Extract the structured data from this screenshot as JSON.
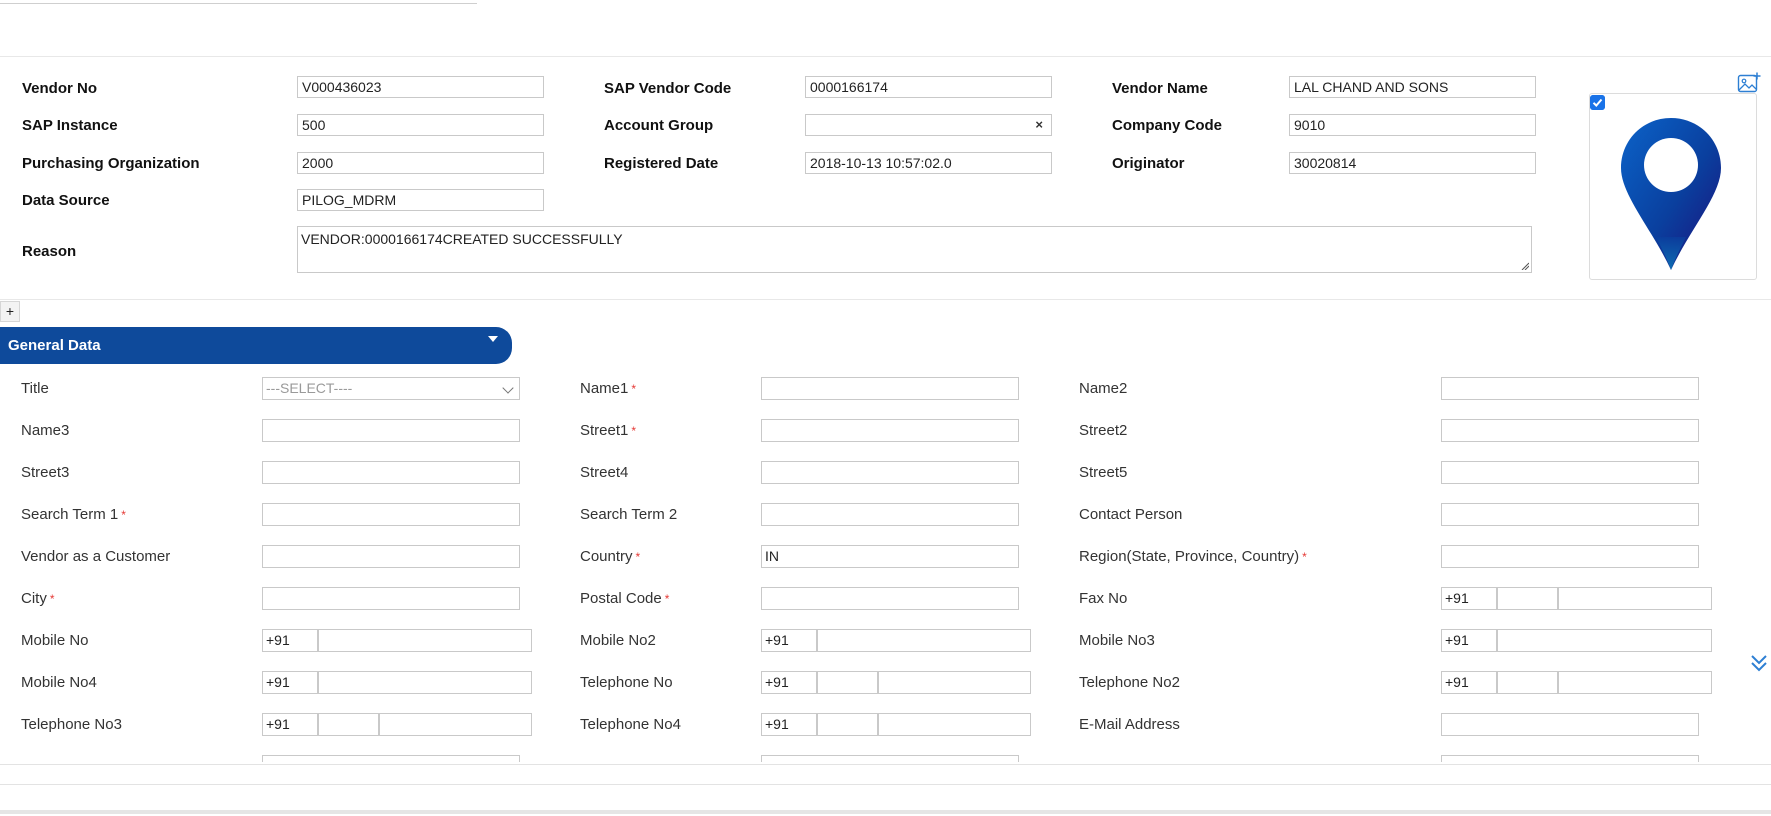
{
  "header": {
    "vendor_no": {
      "label": "Vendor No",
      "value": "V000436023"
    },
    "sap_vendor_code": {
      "label": "SAP Vendor Code",
      "value": "0000166174"
    },
    "vendor_name": {
      "label": "Vendor Name",
      "value": "LAL CHAND AND SONS"
    },
    "sap_instance": {
      "label": "SAP Instance",
      "value": "500"
    },
    "account_group": {
      "label": "Account Group",
      "value": "",
      "clear": "×"
    },
    "company_code": {
      "label": "Company Code",
      "value": "9010"
    },
    "purchasing_org": {
      "label": "Purchasing Organization",
      "value": "2000"
    },
    "registered_date": {
      "label": "Registered Date",
      "value": "2018-10-13 10:57:02.0"
    },
    "originator": {
      "label": "Originator",
      "value": "30020814"
    },
    "data_source": {
      "label": "Data Source",
      "value": "PILOG_MDRM"
    },
    "reason": {
      "label": "Reason",
      "value": "VENDOR:0000166174CREATED SUCCESSFULLY"
    }
  },
  "expand_button": "+",
  "section": {
    "title": "General Data"
  },
  "form": {
    "title": {
      "label": "Title",
      "placeholder": "---SELECT----"
    },
    "name1": {
      "label": "Name1"
    },
    "name2": {
      "label": "Name2"
    },
    "name3": {
      "label": "Name3"
    },
    "street1": {
      "label": "Street1"
    },
    "street2": {
      "label": "Street2"
    },
    "street3": {
      "label": "Street3"
    },
    "street4": {
      "label": "Street4"
    },
    "street5": {
      "label": "Street5"
    },
    "search_term1": {
      "label": "Search Term 1"
    },
    "search_term2": {
      "label": "Search Term 2"
    },
    "contact_person": {
      "label": "Contact Person"
    },
    "vendor_as_customer": {
      "label": "Vendor as a Customer"
    },
    "country": {
      "label": "Country",
      "value": "IN"
    },
    "region": {
      "label": "Region(State, Province, Country)"
    },
    "city": {
      "label": "City"
    },
    "postal_code": {
      "label": "Postal Code"
    },
    "fax_no": {
      "label": "Fax No",
      "code": "+91"
    },
    "mobile_no": {
      "label": "Mobile No",
      "code": "+91"
    },
    "mobile_no2": {
      "label": "Mobile No2",
      "code": "+91"
    },
    "mobile_no3": {
      "label": "Mobile No3",
      "code": "+91"
    },
    "mobile_no4": {
      "label": "Mobile No4",
      "code": "+91"
    },
    "telephone_no": {
      "label": "Telephone No",
      "code": "+91"
    },
    "telephone_no2": {
      "label": "Telephone No2",
      "code": "+91"
    },
    "telephone_no3": {
      "label": "Telephone No3",
      "code": "+91"
    },
    "telephone_no4": {
      "label": "Telephone No4",
      "code": "+91"
    },
    "email": {
      "label": "E-Mail Address"
    },
    "required_mark": "*"
  },
  "colors": {
    "accent": "#0e4a9b",
    "required": "#e53935",
    "checkbox": "#1a73e8"
  },
  "icons": [
    "image-add-icon",
    "location-pin-icon",
    "chevron-down-icon",
    "double-chevron-down-icon",
    "checkbox-icon"
  ]
}
